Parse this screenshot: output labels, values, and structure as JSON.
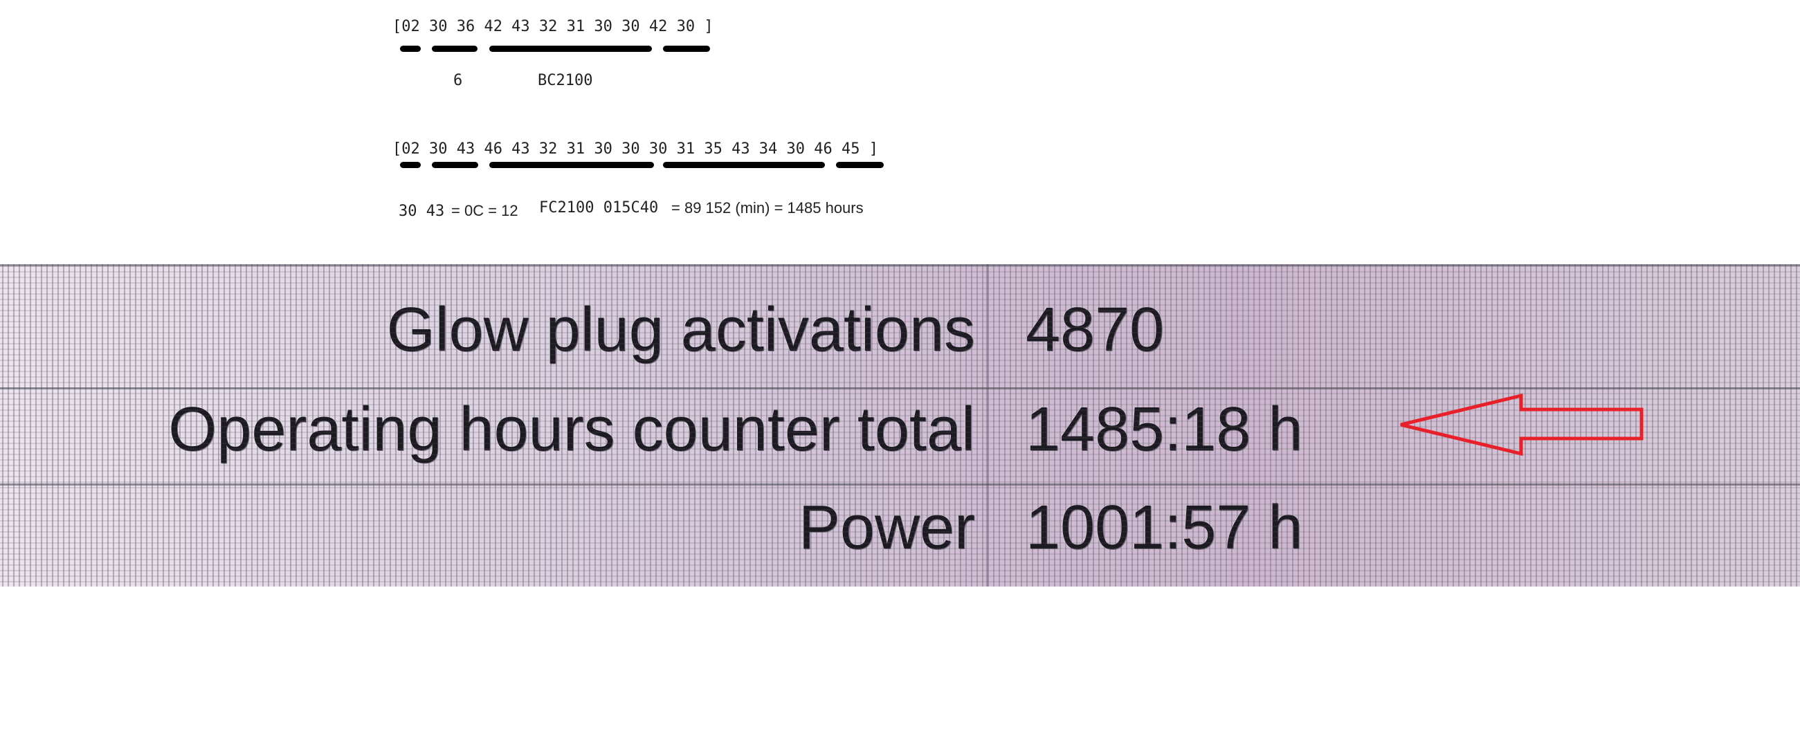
{
  "annotation": {
    "line1": "[02 30 36 42 43 32 31 30 30 42 30 ]",
    "line1_notes": {
      "a": "6",
      "b": "BC2100"
    },
    "line2": "[02 30 43 46 43 32 31 30 30 30 31 35 43 34 30 46 45 ]",
    "line2_notes": {
      "a_mono": "30 43",
      "a_sans": "= 0C = 12",
      "b_mono": "FC2100 015C40",
      "b_sans": "= 89 152 (min) = 1485 hours"
    }
  },
  "screen": {
    "rows": [
      {
        "label": "Glow plug activations",
        "value": "4870"
      },
      {
        "label": "Operating hours counter total",
        "value": "1485:18 h"
      },
      {
        "label": "Power",
        "value": "1001:57 h"
      }
    ]
  },
  "colors": {
    "arrow": "#e8202a",
    "underline": "#000000"
  },
  "icons": {
    "arrow": "arrow-left-outline-icon"
  }
}
